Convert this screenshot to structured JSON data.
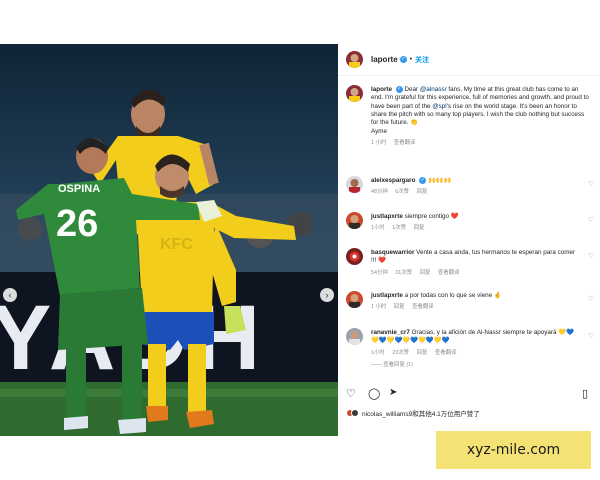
{
  "post": {
    "username": "laporte",
    "follow_label": "关注",
    "separator": "•"
  },
  "caption": {
    "username": "laporte",
    "text_intro": "Dear ",
    "mention1": "@alnassr",
    "text_1": " fans, My time at this great club has come to an end. I'm grateful for this experience, full of memories and growth, and proud to have been part of the ",
    "mention2": "@spl",
    "text_2": "'s rise on the world stage. It's been an honor to share the pitch with so many top players. I wish the club nothing but success for the future. 👏",
    "signature": "Ayme",
    "time": "1 小时",
    "translate": "查看翻译"
  },
  "comments": [
    {
      "username": "aleixespargaro",
      "text": "🙌🙌🙌",
      "time": "48分钟",
      "likes": "6次赞",
      "reply": "回复"
    },
    {
      "username": "justlapxrte",
      "text": "siempre contigo ❤️",
      "time": "1小时",
      "likes": "1次赞",
      "reply": "回复"
    },
    {
      "username": "basquewarrior",
      "text": "Vente a casa anda, tus hermanos te esperan para comer !!! ❤️",
      "time": "54分钟",
      "likes": "31次赞",
      "reply": "回复",
      "translate": "查看翻译"
    },
    {
      "username": "justlapxrte",
      "text": "a por todas con lo que se viene 🤞",
      "time": "1 小时",
      "reply": "回复",
      "translate": "查看翻译"
    },
    {
      "username": "ranavnie_cr7",
      "text": "Gracias, y la afición de Al-Nassr siempre te apoyará 💛💙💛💙💛💙💛💙💛💙💛💙",
      "time": "1小时",
      "likes": "23次赞",
      "reply": "回复",
      "translate": "查看翻译",
      "view_replies": "—— 查看回复 (1)"
    }
  ],
  "liked_by": {
    "text": "nicolas_williams9和其他4.1万位用户赞了"
  },
  "photo": {
    "jersey_name": "OSPINA",
    "jersey_number": "26",
    "banner_text": "YADH"
  },
  "watermark": "xyz-mile.com",
  "colors": {
    "accent_blue": "#0095f6",
    "nassr_yellow": "#f2cd1b",
    "nassr_blue": "#1c4fb8",
    "keeper_green": "#2f8a3c",
    "watermark_bg": "#f4e374"
  }
}
